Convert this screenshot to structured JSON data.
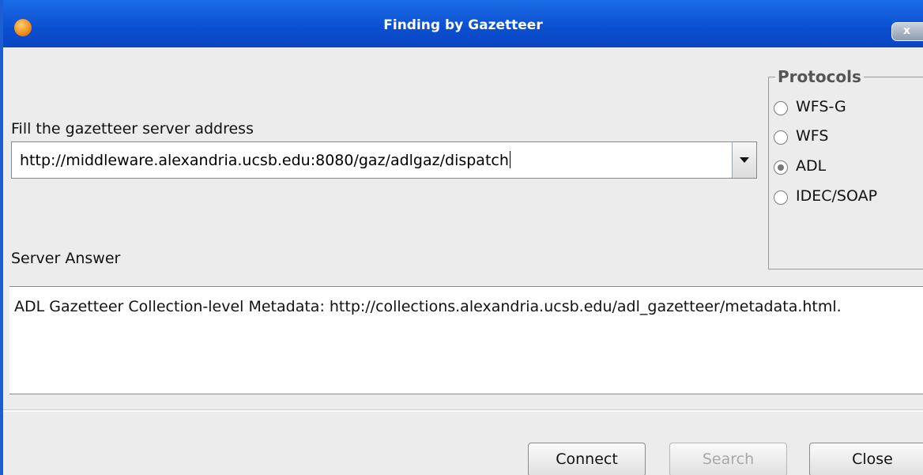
{
  "window": {
    "title": "Finding by Gazetteer",
    "close_label": "x"
  },
  "server": {
    "label": "Fill the gazetteer server address",
    "url": "http://middleware.alexandria.ucsb.edu:8080/gaz/adlgaz/dispatch"
  },
  "protocols": {
    "legend": "Protocols",
    "options": [
      {
        "label": "WFS-G",
        "checked": false
      },
      {
        "label": "WFS",
        "checked": false
      },
      {
        "label": "ADL",
        "checked": true
      },
      {
        "label": "IDEC/SOAP",
        "checked": false
      }
    ]
  },
  "answer": {
    "label": "Server Answer",
    "text": "ADL Gazetteer Collection-level Metadata: http://collections.alexandria.ucsb.edu/adl_gazetteer/metadata.html."
  },
  "buttons": {
    "connect": "Connect",
    "search": "Search",
    "close": "Close"
  }
}
